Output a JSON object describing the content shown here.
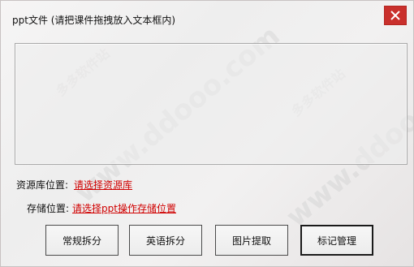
{
  "window": {
    "title": "ppt文件 (请把课件拖拽放入文本框内)",
    "close_icon": "close-icon"
  },
  "library": {
    "label": "资源库位置:",
    "link": "请选择资源库"
  },
  "storage": {
    "label": "存储位置:",
    "link": "请选择ppt操作存储位置"
  },
  "buttons": {
    "regular_split": "常规拆分",
    "english_split": "英语拆分",
    "image_extract": "图片提取",
    "mark_manage": "标记管理"
  },
  "colors": {
    "close_bg": "#c9302c",
    "link": "#d00000",
    "border": "#4a4a4a"
  }
}
